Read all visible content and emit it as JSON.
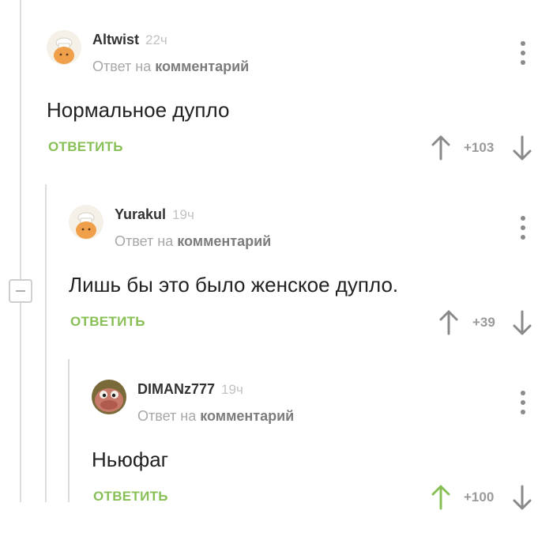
{
  "comments": [
    {
      "author": "Altwist",
      "time": "22ч",
      "reply_prefix": "Ответ на",
      "reply_link": "комментарий",
      "text": "Нормальное дупло",
      "reply_label": "ОТВЕТИТЬ",
      "rating": "+103",
      "upvoted": false
    },
    {
      "author": "Yurakul",
      "time": "19ч",
      "reply_prefix": "Ответ на",
      "reply_link": "комментарий",
      "text": "Лишь бы это было женское дупло.",
      "reply_label": "ОТВЕТИТЬ",
      "rating": "+39",
      "upvoted": false
    },
    {
      "author": "DIMANz777",
      "time": "19ч",
      "reply_prefix": "Ответ на",
      "reply_link": "комментарий",
      "text": "Ньюфаг",
      "reply_label": "ОТВЕТИТЬ",
      "rating": "+100",
      "upvoted": true
    }
  ],
  "colors": {
    "accent": "#88c057",
    "upvote_active": "#88c057",
    "icon": "#8a8a8a"
  },
  "icons": [
    "chef-avatar-icon",
    "chef-avatar-icon",
    "creature-avatar-icon",
    "kebab-menu-icon",
    "collapse-minus-icon",
    "arrow-up-icon",
    "arrow-down-icon"
  ]
}
